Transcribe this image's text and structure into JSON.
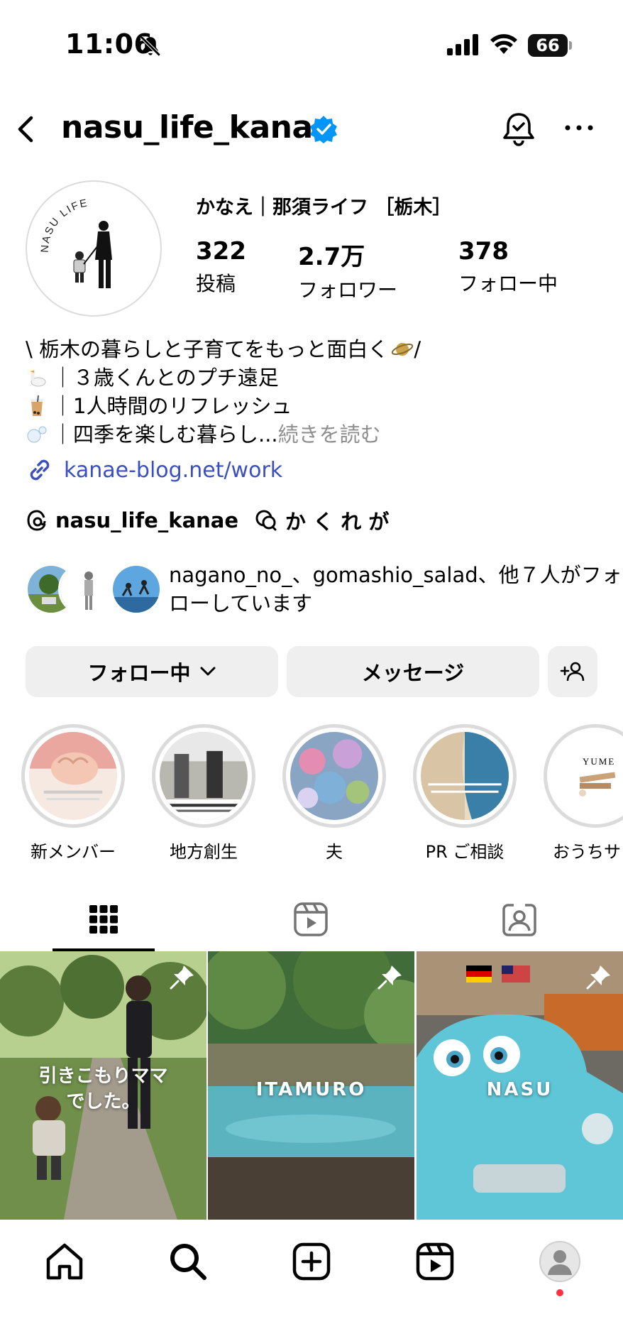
{
  "status_bar": {
    "time": "11:06",
    "battery": "66"
  },
  "header": {
    "username": "nasu_life_kanae"
  },
  "profile": {
    "display_name": "かなえ｜那須ライフ ［栃木］",
    "stats": [
      {
        "value": "322",
        "label": "投稿"
      },
      {
        "value": "2.7万",
        "label": "フォロワー"
      },
      {
        "value": "378",
        "label": "フォロー中"
      }
    ],
    "avatar_text": "NASU LIFE"
  },
  "bio": {
    "line1": "\\ 栃木の暮らしと子育てをもっと面白く",
    "line1_end": " /",
    "line2": "｜３歳くんとのプチ遠足",
    "line3": "｜1人時間のリフレッシュ",
    "line4": "｜四季を楽しむ暮らし...",
    "more": " 続きを読む"
  },
  "link": {
    "text": "kanae-blog.net/work"
  },
  "threads": {
    "handle": "nasu_life_kanae",
    "channel": "か く れ が"
  },
  "mutual": {
    "text": "nagano_no_、gomashio_salad、他７人がフォローしています"
  },
  "buttons": {
    "following": "フォロー中",
    "message": "メッセージ"
  },
  "highlights": [
    {
      "label": "新メンバー"
    },
    {
      "label": "地方創生"
    },
    {
      "label": "夫"
    },
    {
      "label": "PR ご相談"
    },
    {
      "label": "おうちサロ",
      "text": "YUME"
    }
  ],
  "posts": [
    {
      "caption": "引きこもりママ\nでした。"
    },
    {
      "caption": "ITAMURO"
    },
    {
      "caption": "NASU"
    }
  ],
  "colors": {
    "link": "#3b4fbf",
    "verified": "#0095f6",
    "notification_dot": "#ff3040",
    "button_bg": "#efefef"
  }
}
